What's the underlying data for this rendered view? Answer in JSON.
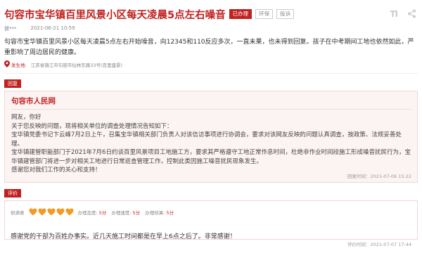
{
  "header": {
    "title": "句容市宝华镇百里风景小区每天凌晨5点左右噪音",
    "status": "已办理",
    "tags": [
      "环保",
      "投诉"
    ],
    "font_icon_label": "TI"
  },
  "meta": {
    "author": "健***",
    "date": "2021-06-21 10:59"
  },
  "content": "句容市宝华镇百里风景小区每天凌晨5点左右开始噪音，向12345和110反应多次，一直未果，也未得到回复。孩子在中考期间工地也依然如此，严重影响了周边居民的健康。",
  "location": {
    "label": "发生地:",
    "address": "江苏省镇江市句容市仙林东路33号(百里盛景)"
  },
  "reply": {
    "section_label": "回复",
    "org": "句容市人民网",
    "paragraphs": [
      "网友，你好",
      "关于您反映的问题，现将相关单位的调查处理情况告知如下：",
      "宝华镇党委书记卞云峰7月2日上午，召集宝华镇相关部门负责人对该信访事项进行协调会，要求对该网友反映的问题认真调查，按政策、法规妥善处理。",
      "宝华镇建管职能部门于2021年7月6日约谈百里风景项目工地施工方，要求其严格遵守工地正常作息时间，杜绝非作业时间段施工形成噪音扰民行为，宝华镇建管部门将进一步对相关工地进行日常巡查管理工作，控制此类因施工噪音扰民现象发生。",
      "感谢您对我们工作的关心和支持！"
    ],
    "time": "回复时间：2021-07-06 15:22"
  },
  "evaluation": {
    "section_label": "评价",
    "attitude_label": "很满意",
    "heart_count": 5,
    "scores": [
      {
        "label": "办理态度:",
        "value": "5分"
      },
      {
        "label": "办理速度:",
        "value": "5分"
      },
      {
        "label": "办理结果:",
        "value": "5分"
      }
    ],
    "text": "感谢党的干部为百姓办事实。近几天施工时间都是在早上6点之后了。非常感谢！",
    "time": "评价时间：2021-07-07 17:44"
  },
  "colors": {
    "brand_red": "#c0211f",
    "heart_orange": "#f39a22"
  }
}
